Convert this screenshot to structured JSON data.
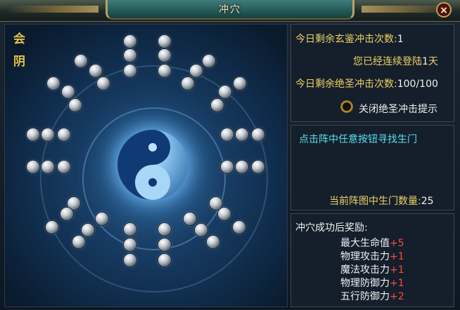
{
  "window": {
    "title": "冲穴",
    "close_label": "×"
  },
  "meridian": {
    "label_chars": [
      "会",
      "阴"
    ]
  },
  "info": {
    "xuanjian_label": "今日剩余玄鉴冲击次数:",
    "xuanjian_value": "1",
    "login_prefix": "您已经连续登陆",
    "login_days": "1",
    "login_suffix": "天",
    "juesheng_label": "今日剩余绝圣冲击次数:",
    "juesheng_value": "100/100",
    "toggle_label": "关闭绝圣冲击提示"
  },
  "hint": {
    "text": "点击阵中任意按钮寻找生门",
    "count_label": "当前阵图中生门数量:",
    "count_value": "25"
  },
  "rewards": {
    "title": "冲穴成功后奖励:",
    "items": [
      {
        "name": "最大生命值",
        "bonus": "+5"
      },
      {
        "name": "物理攻击力",
        "bonus": "+1"
      },
      {
        "name": "魔法攻击力",
        "bonus": "+1"
      },
      {
        "name": "物理防御力",
        "bonus": "+1"
      },
      {
        "name": "五行防御力",
        "bonus": "+2"
      }
    ]
  },
  "colors": {
    "gold": "#f0d264",
    "cyan": "#58e0f0",
    "red": "#ff4a3a"
  }
}
